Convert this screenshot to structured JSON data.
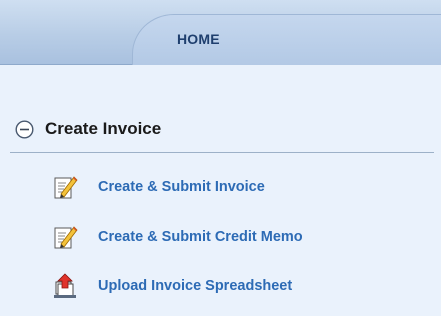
{
  "nav": {
    "home_tab_label": "HOME"
  },
  "section": {
    "title": "Create Invoice",
    "collapse_icon": "minus-circle-icon",
    "items": [
      {
        "label": "Create & Submit Invoice",
        "icon": "edit-document-icon"
      },
      {
        "label": "Create & Submit Credit Memo",
        "icon": "edit-document-icon"
      },
      {
        "label": "Upload Invoice Spreadsheet",
        "icon": "upload-stack-icon"
      }
    ]
  },
  "colors": {
    "link": "#2d6bb5",
    "panel_bg": "#eaf2fc",
    "tab_text": "#1f3f6e"
  }
}
